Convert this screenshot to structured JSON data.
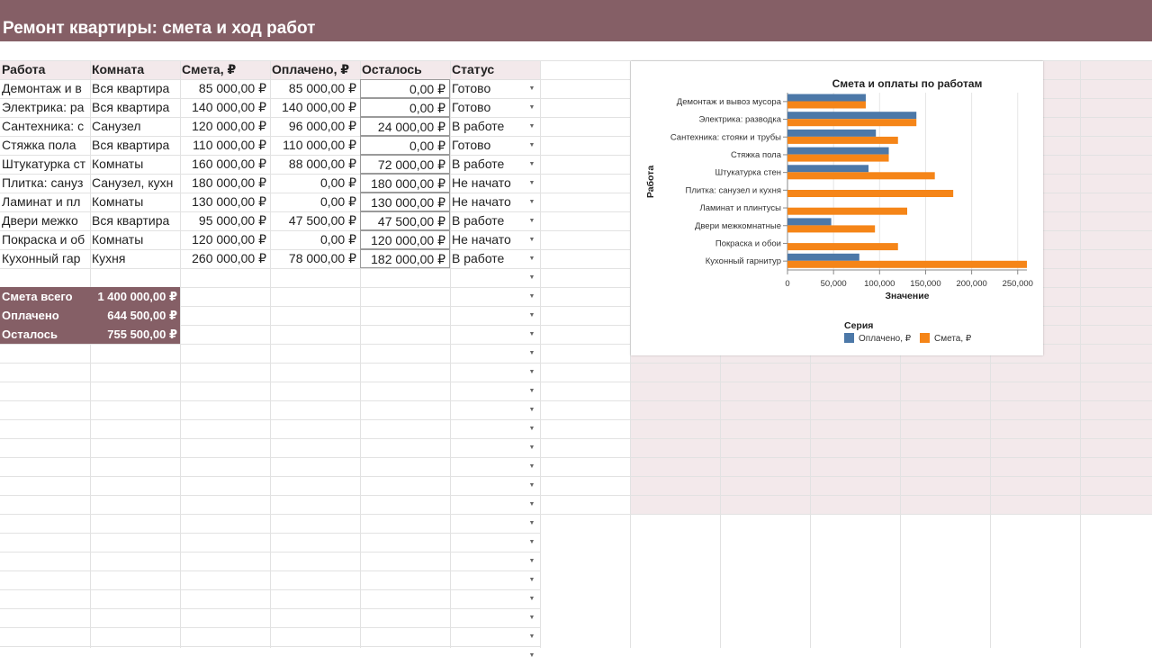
{
  "sheet": {
    "title": "Ремонт квартиры: смета и ход работ",
    "headers": [
      "Работа",
      "Комната",
      "Смета, ₽",
      "Оплачено, ₽",
      "Осталось",
      "Статус"
    ],
    "rows": [
      {
        "work": "Демонтаж и в",
        "room": "Вся квартира",
        "estimate": "85 000,00 ₽",
        "paid": "85 000,00 ₽",
        "left": "0,00 ₽",
        "status": "Готово"
      },
      {
        "work": "Электрика: ра",
        "room": "Вся квартира",
        "estimate": "140 000,00 ₽",
        "paid": "140 000,00 ₽",
        "left": "0,00 ₽",
        "status": "Готово"
      },
      {
        "work": "Сантехника: с",
        "room": "Санузел",
        "estimate": "120 000,00 ₽",
        "paid": "96 000,00 ₽",
        "left": "24 000,00 ₽",
        "status": "В работе"
      },
      {
        "work": "Стяжка пола",
        "room": "Вся квартира",
        "estimate": "110 000,00 ₽",
        "paid": "110 000,00 ₽",
        "left": "0,00 ₽",
        "status": "Готово"
      },
      {
        "work": "Штукатурка ст",
        "room": "Комнаты",
        "estimate": "160 000,00 ₽",
        "paid": "88 000,00 ₽",
        "left": "72 000,00 ₽",
        "status": "В работе"
      },
      {
        "work": "Плитка: сануз",
        "room": "Санузел, кухн",
        "estimate": "180 000,00 ₽",
        "paid": "0,00 ₽",
        "left": "180 000,00 ₽",
        "status": "Не начато"
      },
      {
        "work": "Ламинат и пл",
        "room": "Комнаты",
        "estimate": "130 000,00 ₽",
        "paid": "0,00 ₽",
        "left": "130 000,00 ₽",
        "status": "Не начато"
      },
      {
        "work": "Двери межко",
        "room": "Вся квартира",
        "estimate": "95 000,00 ₽",
        "paid": "47 500,00 ₽",
        "left": "47 500,00 ₽",
        "status": "В работе"
      },
      {
        "work": "Покраска и об",
        "room": "Комнаты",
        "estimate": "120 000,00 ₽",
        "paid": "0,00 ₽",
        "left": "120 000,00 ₽",
        "status": "Не начато"
      },
      {
        "work": "Кухонный гар",
        "room": "Кухня",
        "estimate": "260 000,00 ₽",
        "paid": "78 000,00 ₽",
        "left": "182 000,00 ₽",
        "status": "В работе"
      }
    ],
    "summary": [
      {
        "label": "Смета всего",
        "value": "1 400 000,00 ₽"
      },
      {
        "label": "Оплачено",
        "value": "644 500,00 ₽"
      },
      {
        "label": "Осталось",
        "value": "755 500,00 ₽"
      }
    ]
  },
  "chart_data": {
    "type": "bar",
    "orientation": "horizontal",
    "title": "Смета и оплаты по работам",
    "xlabel": "Значение",
    "ylabel": "Работа",
    "categories": [
      "Демонтаж и вывоз мусора",
      "Электрика: разводка",
      "Сантехника: стояки и трубы",
      "Стяжка пола",
      "Штукатурка стен",
      "Плитка: санузел и кухня",
      "Ламинат и плинтусы",
      "Двери межкомнатные",
      "Покраска и обои",
      "Кухонный гарнитур"
    ],
    "series": [
      {
        "name": "Оплачено, ₽",
        "color": "#4c78a8",
        "values": [
          85000,
          140000,
          96000,
          110000,
          88000,
          0,
          0,
          47500,
          0,
          78000
        ]
      },
      {
        "name": "Смета, ₽",
        "color": "#f58518",
        "values": [
          85000,
          140000,
          120000,
          110000,
          160000,
          180000,
          130000,
          95000,
          120000,
          260000
        ]
      }
    ],
    "xlim": [
      0,
      260000
    ],
    "xticks": [
      "0",
      "50,000",
      "100,000",
      "150,000",
      "200,000",
      "250,000"
    ],
    "legend_title": "Серия",
    "legend_position": "bottom",
    "grid": true
  }
}
